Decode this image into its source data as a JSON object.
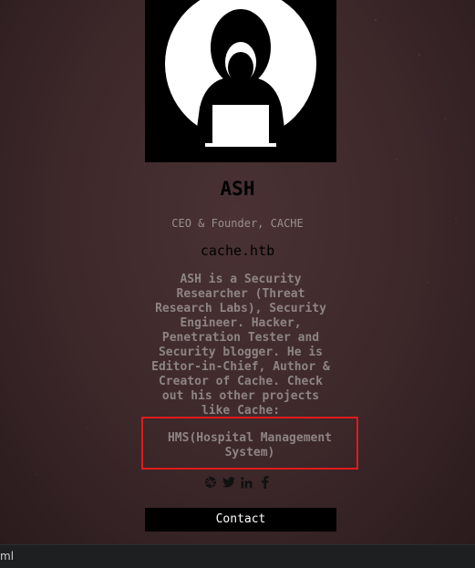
{
  "profile": {
    "avatar_icon": "hooded-hacker-icon",
    "name": "ASH",
    "role": "CEO & Founder, CACHE",
    "site": "cache.htb",
    "bio": "ASH is a Security Researcher (Threat Research Labs), Security Engineer. Hacker, Penetration Tester and Security blogger. He is Editor-in-Chief, Author & Creator of Cache. Check out his other projects like Cache:",
    "project": "HMS(Hospital Management System)"
  },
  "social": [
    {
      "icon": "dribbble-icon"
    },
    {
      "icon": "twitter-icon"
    },
    {
      "icon": "linkedin-icon"
    },
    {
      "icon": "facebook-icon"
    }
  ],
  "contact_label": "Contact",
  "status_bar": {
    "url_fragment": "ml"
  },
  "colors": {
    "background": "#3c2729",
    "highlight_border": "#e01b1b",
    "button_bg": "#000000"
  }
}
